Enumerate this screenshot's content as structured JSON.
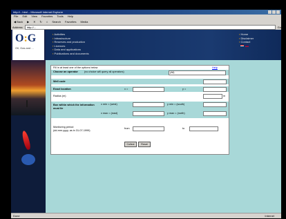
{
  "window": {
    "title": "http://...html – Microsoft Internet Explorer"
  },
  "menu": [
    "File",
    "Edit",
    "View",
    "Favorites",
    "Tools",
    "Help"
  ],
  "toolbar": {
    "back_label": "Back",
    "search_label": "Search",
    "favorites_label": "Favorites",
    "media_label": "Media"
  },
  "address": {
    "label": "Address",
    "value": "http://...",
    "go_label": "Go"
  },
  "site": {
    "logo_text": "OG",
    "logo_subtitle": "Oil, Gas and ...",
    "nav_left": [
      "Activities",
      "Infrastructure",
      "Reserves and production",
      "Licences",
      "Data and applications",
      "Publications and documents"
    ],
    "nav_right": [
      "Home",
      "Disclaimer",
      "Contact"
    ]
  },
  "form": {
    "intro": "Fill in at least one of the options below",
    "help_label": "Help",
    "operator_label": "Choose an operator",
    "operator_hint": "(no choice will query all operators)",
    "operator_value": "(All)",
    "well_code_label": "Well code",
    "exact_location_label": "Exact location",
    "x_label": "x =",
    "y_label": "y =",
    "radius_label": "Radius (m)",
    "radius_unit": "m",
    "box_label": "Box within which the information must lie",
    "xmin_label": "x min = (west)",
    "ymin_label": "y min = (south)",
    "xmax_label": "x max = (east)",
    "ymax_label": "y max = (north)",
    "period_label": "Monitoring period",
    "period_hint": "(dd-mm-yyyy, as in 31-07-1999)",
    "from_label": "from",
    "to_label": "to",
    "submit_label": "Collect",
    "reset_label": "Reset"
  },
  "status": {
    "left": "Done",
    "right": "Internet"
  },
  "colors": {
    "page_bg": "#a8d8d8",
    "banner": "#1a3a70",
    "accent": "#e0a020"
  }
}
